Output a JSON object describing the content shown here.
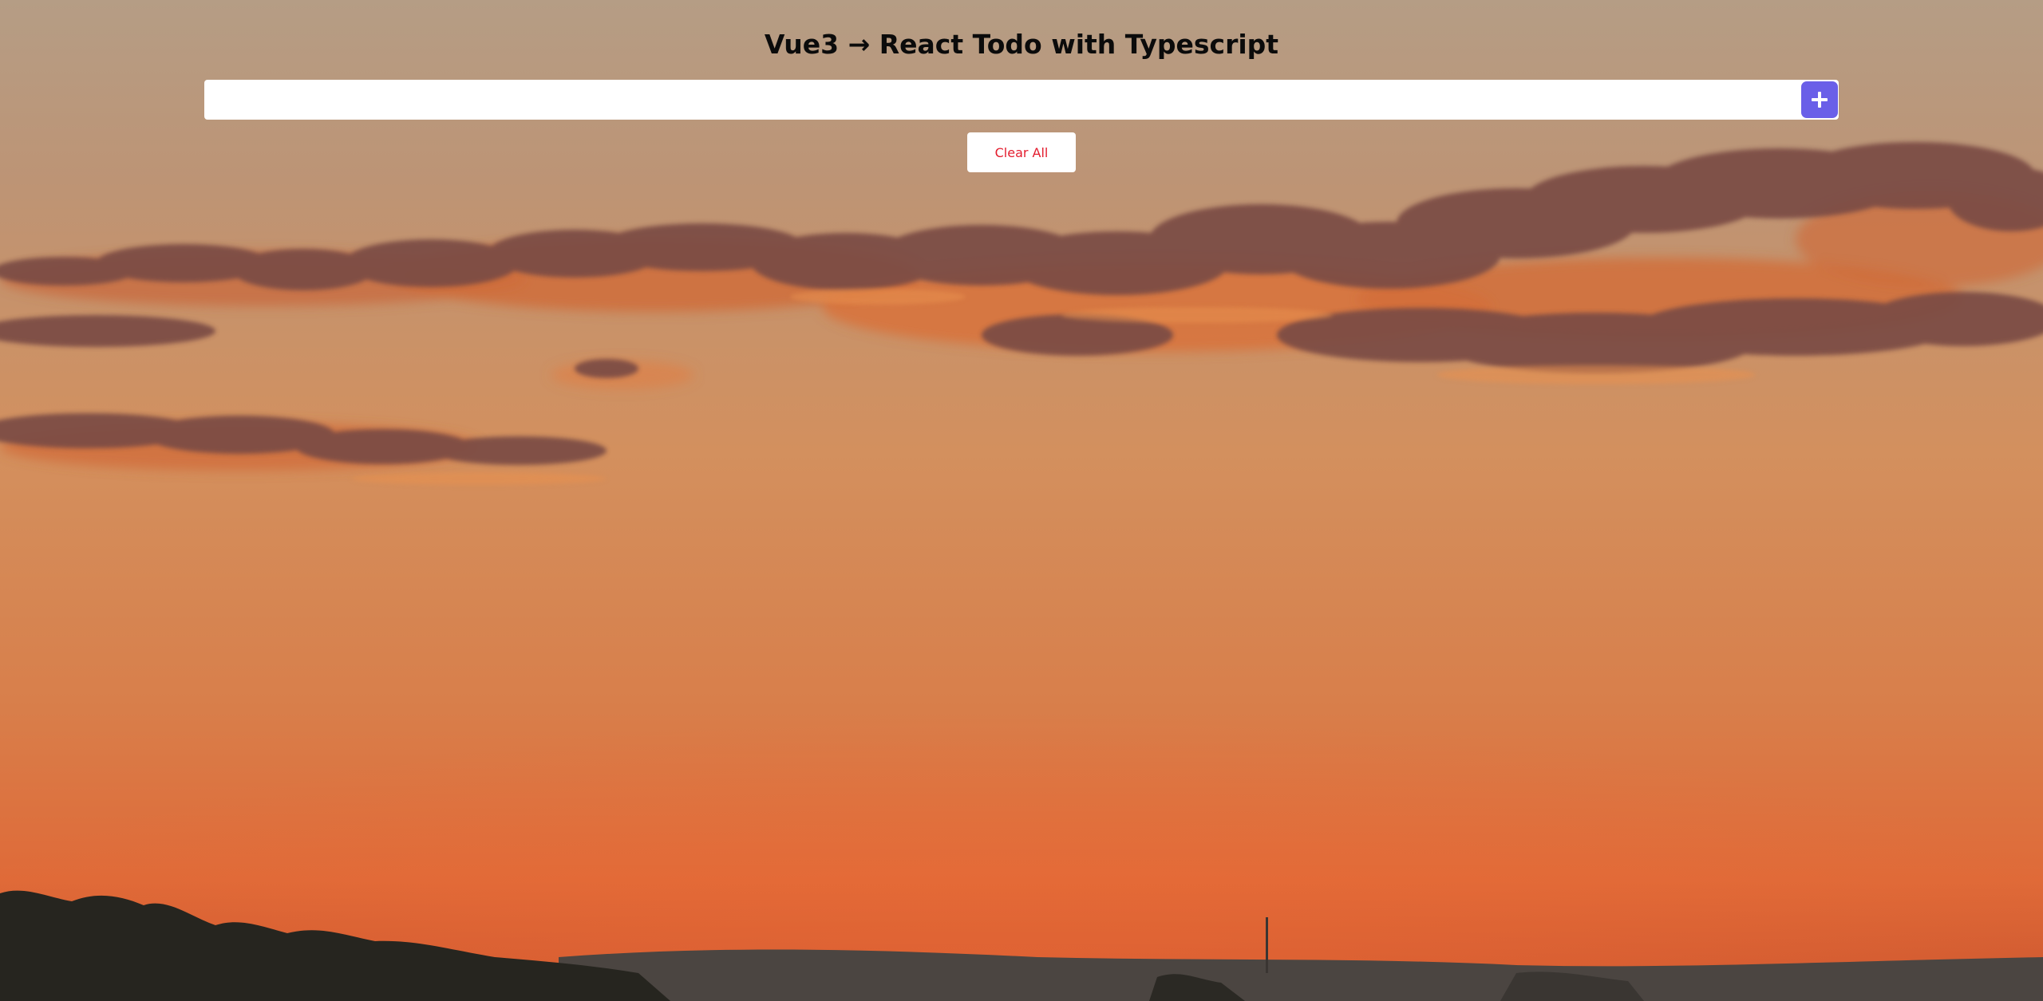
{
  "app": {
    "title": "Vue3 → React Todo with Typescript"
  },
  "todo_input": {
    "value": "",
    "placeholder": ""
  },
  "add_button": {
    "icon": "plus-icon",
    "color": "#6a5fe8"
  },
  "clear_button": {
    "label": "Clear All",
    "text_color": "#e31d2e"
  },
  "background": {
    "image": "sunset-sky-photo",
    "sky_top_color": "#b29a82",
    "sky_mid_color": "#d68a55",
    "horizon_color": "#dd6233",
    "treeline_color": "#2a2824"
  }
}
